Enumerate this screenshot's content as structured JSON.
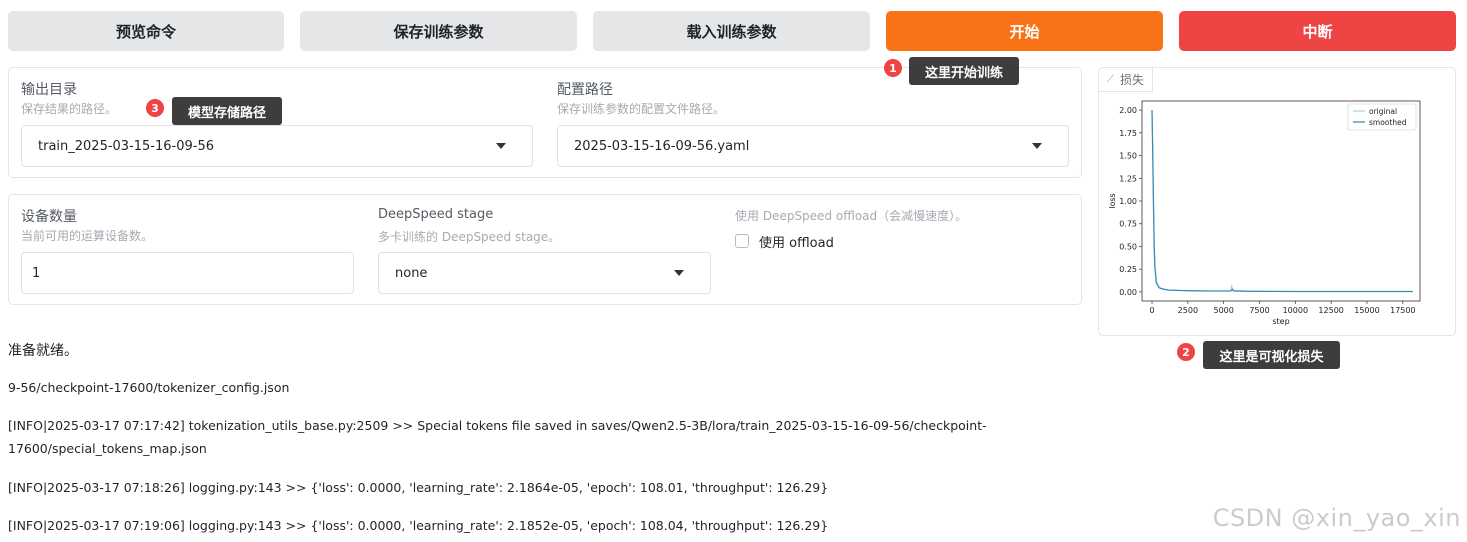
{
  "toolbar": {
    "preview_label": "预览命令",
    "save_label": "保存训练参数",
    "load_label": "载入训练参数",
    "start_label": "开始",
    "stop_label": "中断"
  },
  "output_panel": {
    "output_dir": {
      "label": "输出目录",
      "info": "保存结果的路径。",
      "value": "train_2025-03-15-16-09-56"
    },
    "config_path": {
      "label": "配置路径",
      "info": "保存训练参数的配置文件路径。",
      "value": "2025-03-15-16-09-56.yaml"
    }
  },
  "device_panel": {
    "device_count": {
      "label": "设备数量",
      "info": "当前可用的运算设备数。",
      "value": "1"
    },
    "ds_stage": {
      "label": "DeepSpeed stage",
      "info": "多卡训练的 DeepSpeed stage。",
      "value": "none"
    },
    "ds_offload": {
      "info": "使用 DeepSpeed offload（会减慢速度）。",
      "label": "使用 offload",
      "checked": false
    }
  },
  "annotations": {
    "one": {
      "num": "1",
      "text": "这里开始训练"
    },
    "two": {
      "num": "2",
      "text": "这里是可视化损失"
    },
    "three": {
      "num": "3",
      "text": "模型存储路径"
    }
  },
  "loss_panel": {
    "tab_label": "损失"
  },
  "chart_data": {
    "type": "line",
    "title": "",
    "xlabel": "step",
    "ylabel": "loss",
    "xlim": [
      -700,
      18700
    ],
    "ylim": [
      -0.1,
      2.1
    ],
    "xticks": [
      0,
      2500,
      5000,
      7500,
      10000,
      12500,
      15000,
      17500
    ],
    "xtick_labels": [
      "0",
      "2500",
      "5000",
      "7500",
      "10000",
      "12500",
      "15000",
      "17500"
    ],
    "yticks": [
      0.0,
      0.25,
      0.5,
      0.75,
      1.0,
      1.25,
      1.5,
      1.75,
      2.0
    ],
    "ytick_labels": [
      "0.00",
      "0.25",
      "0.50",
      "0.75",
      "1.00",
      "1.25",
      "1.50",
      "1.75",
      "2.00"
    ],
    "legend_position": "top-right",
    "series": [
      {
        "name": "original",
        "color": "#a8d4e0",
        "x": [
          0,
          50,
          100,
          150,
          200,
          300,
          500,
          800,
          1200,
          2000,
          3000,
          4000,
          5000,
          5500,
          5560,
          5620,
          5700,
          6500,
          8000,
          10000,
          12000,
          14000,
          16000,
          18200
        ],
        "y": [
          2.0,
          1.6,
          1.0,
          0.55,
          0.3,
          0.12,
          0.05,
          0.03,
          0.02,
          0.015,
          0.012,
          0.01,
          0.01,
          0.01,
          0.08,
          0.01,
          0.01,
          0.008,
          0.006,
          0.005,
          0.005,
          0.005,
          0.005,
          0.005
        ]
      },
      {
        "name": "smoothed",
        "color": "#3b8bb5",
        "x": [
          0,
          50,
          100,
          150,
          200,
          300,
          500,
          800,
          1200,
          2000,
          3000,
          4000,
          5000,
          5500,
          5600,
          5700,
          6500,
          8000,
          10000,
          12000,
          14000,
          16000,
          18200
        ],
        "y": [
          2.0,
          1.55,
          0.95,
          0.5,
          0.27,
          0.1,
          0.045,
          0.03,
          0.02,
          0.015,
          0.012,
          0.01,
          0.01,
          0.01,
          0.03,
          0.012,
          0.008,
          0.006,
          0.005,
          0.005,
          0.005,
          0.005,
          0.005
        ]
      }
    ]
  },
  "status": "准备就绪。",
  "logs": [
    "9-56/checkpoint-17600/tokenizer_config.json",
    "[INFO|2025-03-17 07:17:42] tokenization_utils_base.py:2509 >> Special tokens file saved in saves/Qwen2.5-3B/lora/train_2025-03-15-16-09-56/checkpoint-",
    "17600/special_tokens_map.json",
    "[INFO|2025-03-17 07:18:26] logging.py:143 >> {'loss': 0.0000, 'learning_rate': 2.1864e-05, 'epoch': 108.01, 'throughput': 126.29}",
    "[INFO|2025-03-17 07:19:06] logging.py:143 >> {'loss': 0.0000, 'learning_rate': 2.1852e-05, 'epoch': 108.04, 'throughput': 126.29}"
  ],
  "watermark": "CSDN @xin_yao_xin"
}
